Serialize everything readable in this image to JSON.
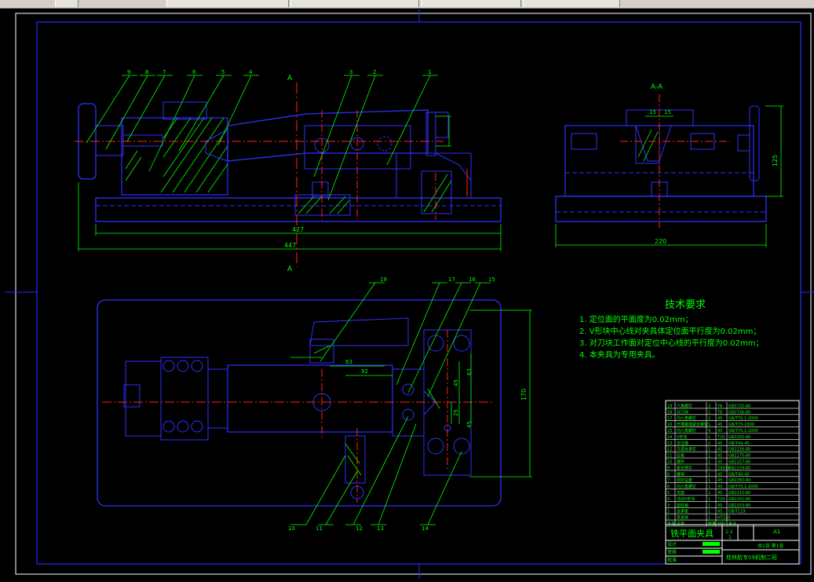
{
  "taskbar": {
    "tabs": [
      {
        "label": ""
      },
      {
        "label": ""
      },
      {
        "label": ""
      },
      {
        "label": ""
      },
      {
        "label": ""
      }
    ]
  },
  "drawing": {
    "section_mark_top": "A",
    "section_mark_bottom": "A",
    "section_title": "A-A",
    "balloons_front": [
      "9",
      "8",
      "7",
      "6",
      "5",
      "4",
      "3",
      "2",
      "1"
    ],
    "balloons_top_upper": [
      "19",
      "17",
      "16",
      "15"
    ],
    "balloons_top_lower": [
      "10",
      "11",
      "12",
      "13",
      "14"
    ],
    "dims": {
      "d427": "427",
      "d447": "447",
      "d220": "220",
      "d125": "125",
      "d15a": "15",
      "d15b": "15",
      "d63": "63",
      "d92": "92",
      "d45a": "45",
      "d45b": "45",
      "d25": "25",
      "d170": "170",
      "d63v": "63"
    }
  },
  "requirements": {
    "title": "技术要求",
    "lines": [
      "1. 定位面的平面度为0.02mm；",
      "2. V形块中心线对夹具体定位面平行度为0.02mm；",
      "3. 对刀块工作面对定位中心线的平行度为0.02mm；",
      "4. 本夹具为专用夹具。"
    ]
  },
  "title_block": {
    "name": "铣平面夹具",
    "scale": "1:1",
    "size": "A1",
    "count": "1",
    "sheets": "共1张 第1张",
    "school": "桂林航专09机制二班",
    "bom": [
      {
        "no": "19",
        "name": "六角螺钉",
        "qty": "3",
        "mat": "Y8",
        "std": "GB5735-80"
      },
      {
        "no": "18",
        "name": "对刀块",
        "qty": "1",
        "mat": "T8",
        "std": "GB5736-80"
      },
      {
        "no": "17",
        "name": "内六角螺钉",
        "qty": "2",
        "mat": "45",
        "std": "GB/T70.1-2000"
      },
      {
        "no": "16",
        "name": "开槽锥端紧定螺钉",
        "qty": "1",
        "mat": "45",
        "std": "GB/T75-2000"
      },
      {
        "no": "15",
        "name": "内六角螺钉",
        "qty": "4",
        "mat": "45",
        "std": "GB/T70.1-2000"
      },
      {
        "no": "14",
        "name": "V形块",
        "qty": "1",
        "mat": "T20",
        "std": "GB2201-80"
      },
      {
        "no": "13",
        "name": "定位键",
        "qty": "2",
        "mat": "45",
        "std": "GB/T40-45"
      },
      {
        "no": "12",
        "name": "可调支承钉",
        "qty": "1",
        "mat": "45",
        "std": "GB2226-80"
      },
      {
        "no": "11",
        "name": "压板",
        "qty": "1",
        "mat": "45",
        "std": "GB2175-80"
      },
      {
        "no": "10",
        "name": "螺杆",
        "qty": "1",
        "mat": "45",
        "std": "GB2157-80"
      },
      {
        "no": "9",
        "name": "星形把手",
        "qty": "1",
        "mat": "Z6010",
        "std": "GB2229-80"
      },
      {
        "no": "8",
        "name": "螺母",
        "qty": "1",
        "mat": "45",
        "std": "GB/T40-45"
      },
      {
        "no": "7",
        "name": "固定钻套",
        "qty": "1",
        "mat": "45",
        "std": "GB2280-80"
      },
      {
        "no": "6",
        "name": "内六角螺钉",
        "qty": "1",
        "mat": "45",
        "std": "GB/T70.1-2000"
      },
      {
        "no": "5",
        "name": "支座",
        "qty": "1",
        "mat": "45",
        "std": "GB2210-80"
      },
      {
        "no": "4",
        "name": "活动V形块",
        "qty": "1",
        "mat": "T20",
        "std": "GB2201-80"
      },
      {
        "no": "3",
        "name": "圆柱销",
        "qty": "1",
        "mat": "45",
        "std": "GB2203-80"
      },
      {
        "no": "2",
        "name": "支承板",
        "qty": "1",
        "mat": "45",
        "std": "GB/T119"
      },
      {
        "no": "1",
        "name": "夹具体",
        "qty": "1",
        "mat": "HT150",
        "std": ""
      }
    ],
    "header": [
      "序号",
      "名称",
      "数量",
      "材料",
      "备注"
    ],
    "roles": [
      "设计",
      "审核",
      "批准"
    ]
  }
}
